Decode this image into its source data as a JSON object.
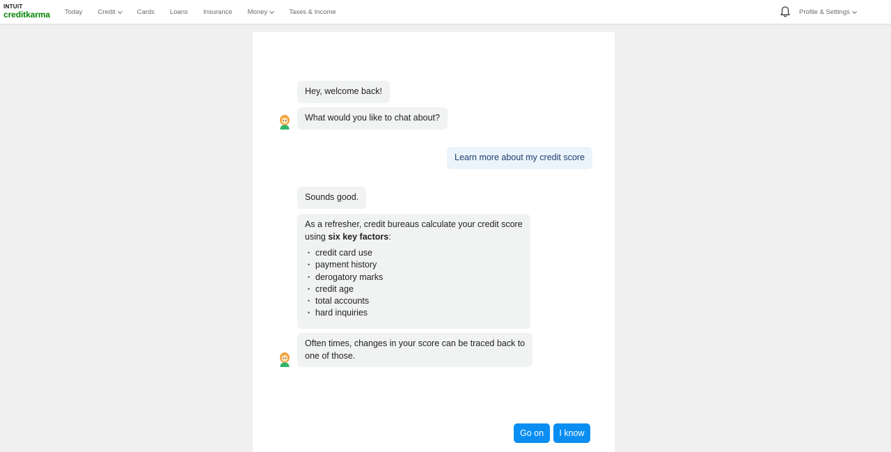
{
  "header": {
    "logo": {
      "line1": "INTUIT",
      "line2": "creditkarma"
    },
    "nav": [
      {
        "label": "Today",
        "dropdown": false
      },
      {
        "label": "Credit",
        "dropdown": true
      },
      {
        "label": "Cards",
        "dropdown": false
      },
      {
        "label": "Loans",
        "dropdown": false
      },
      {
        "label": "Insurance",
        "dropdown": false
      },
      {
        "label": "Money",
        "dropdown": true
      },
      {
        "label": "Taxes & Income",
        "dropdown": false
      }
    ],
    "profile_label": "Profile & Settings",
    "notification_icon": "bell-icon"
  },
  "chat": {
    "greeting": "Hey, welcome back!",
    "question": "What would you like to chat about?",
    "user_reply": "Learn more about my credit score",
    "ack": "Sounds good.",
    "refresher_intro": "As a refresher, credit bureaus calculate your credit score",
    "refresher_lead": "using ",
    "refresher_bold": "six key factors",
    "refresher_tail": ":",
    "factors": [
      "credit card use",
      "payment history",
      "derogatory marks",
      "credit age",
      "total accounts",
      "hard inquiries"
    ],
    "closing_line1": "Often times, changes in your score can be traced back to",
    "closing_line2": "one of those."
  },
  "actions": {
    "go_on": "Go on",
    "i_know": "I know"
  },
  "colors": {
    "brand_green": "#008600",
    "primary_button": "#0a8ef2",
    "bot_bubble": "#f1f2f2",
    "user_bubble": "#ecf4fb",
    "page_background": "#f0f0f0"
  }
}
